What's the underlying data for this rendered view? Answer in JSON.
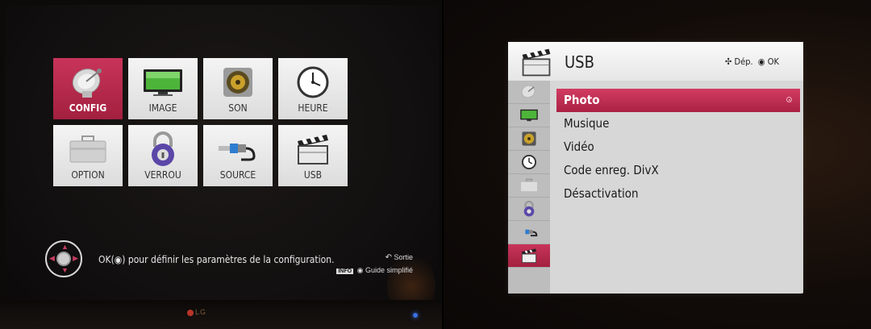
{
  "left_screen": {
    "tiles": [
      {
        "label": "CONFIG",
        "icon": "satellite-dish-icon",
        "active": true
      },
      {
        "label": "IMAGE",
        "icon": "tv-screen-icon",
        "active": false
      },
      {
        "label": "SON",
        "icon": "speaker-icon",
        "active": false
      },
      {
        "label": "HEURE",
        "icon": "clock-icon",
        "active": false
      },
      {
        "label": "OPTION",
        "icon": "toolbox-icon",
        "active": false
      },
      {
        "label": "VERROU",
        "icon": "padlock-icon",
        "active": false
      },
      {
        "label": "SOURCE",
        "icon": "cable-connector-icon",
        "active": false
      },
      {
        "label": "USB",
        "icon": "clapperboard-icon",
        "active": false
      }
    ],
    "help_text": "OK(◉) pour définir les paramètres de la configuration.",
    "exit_label": "Sortie",
    "info_key": "INFO",
    "guide_label": "Guide simplifié",
    "brand": "LG",
    "colors": {
      "accent": "#b42a4c",
      "tile": "#e8e8e8"
    }
  },
  "right_screen": {
    "header": {
      "title": "USB",
      "icon": "clapperboard-icon",
      "nav_hint": "Dép.",
      "ok_hint": "OK"
    },
    "side_icons": [
      "satellite-dish-icon",
      "tv-screen-icon",
      "speaker-icon",
      "clock-icon",
      "toolbox-icon",
      "padlock-icon",
      "cable-connector-icon",
      "clapperboard-icon"
    ],
    "active_side_index": 7,
    "menu": [
      {
        "label": "Photo",
        "selected": true
      },
      {
        "label": "Musique",
        "selected": false
      },
      {
        "label": "Vidéo",
        "selected": false
      },
      {
        "label": "Code enreg. DivX",
        "selected": false
      },
      {
        "label": "Désactivation",
        "selected": false
      }
    ],
    "colors": {
      "accent": "#c8345a",
      "panel": "#d7d7d7"
    }
  }
}
